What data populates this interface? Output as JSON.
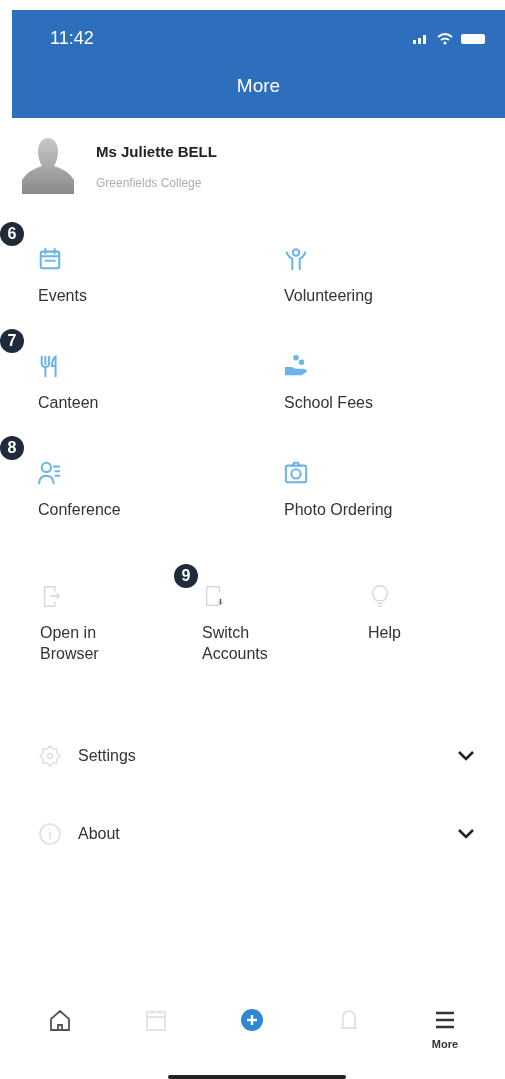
{
  "status_bar": {
    "time": "11:42"
  },
  "header": {
    "title": "More"
  },
  "profile": {
    "name": "Ms Juliette BELL",
    "school": "Greenfields College"
  },
  "features": [
    {
      "kind": "calendar",
      "label": "Events",
      "callout": "6"
    },
    {
      "kind": "volunteer",
      "label": "Volunteering"
    },
    {
      "kind": "cutlery",
      "label": "Canteen",
      "callout": "7"
    },
    {
      "kind": "fees",
      "label": "School Fees"
    },
    {
      "kind": "conference",
      "label": "Conference",
      "callout": "8"
    },
    {
      "kind": "camera",
      "label": "Photo Ordering"
    }
  ],
  "utilities": [
    {
      "kind": "browser",
      "label": "Open in Browser"
    },
    {
      "kind": "switch",
      "label": "Switch Accounts",
      "callout": "9"
    },
    {
      "kind": "bulb",
      "label": "Help"
    }
  ],
  "sections": [
    {
      "kind": "gear",
      "label": "Settings",
      "expanded": false
    },
    {
      "kind": "info",
      "label": "About",
      "expanded": false
    }
  ],
  "tabs": [
    {
      "kind": "home",
      "selected": false
    },
    {
      "kind": "calendar",
      "selected": false
    },
    {
      "kind": "add",
      "selected": false
    },
    {
      "kind": "bell",
      "selected": false
    },
    {
      "kind": "menu",
      "label": "More",
      "selected": true
    }
  ]
}
